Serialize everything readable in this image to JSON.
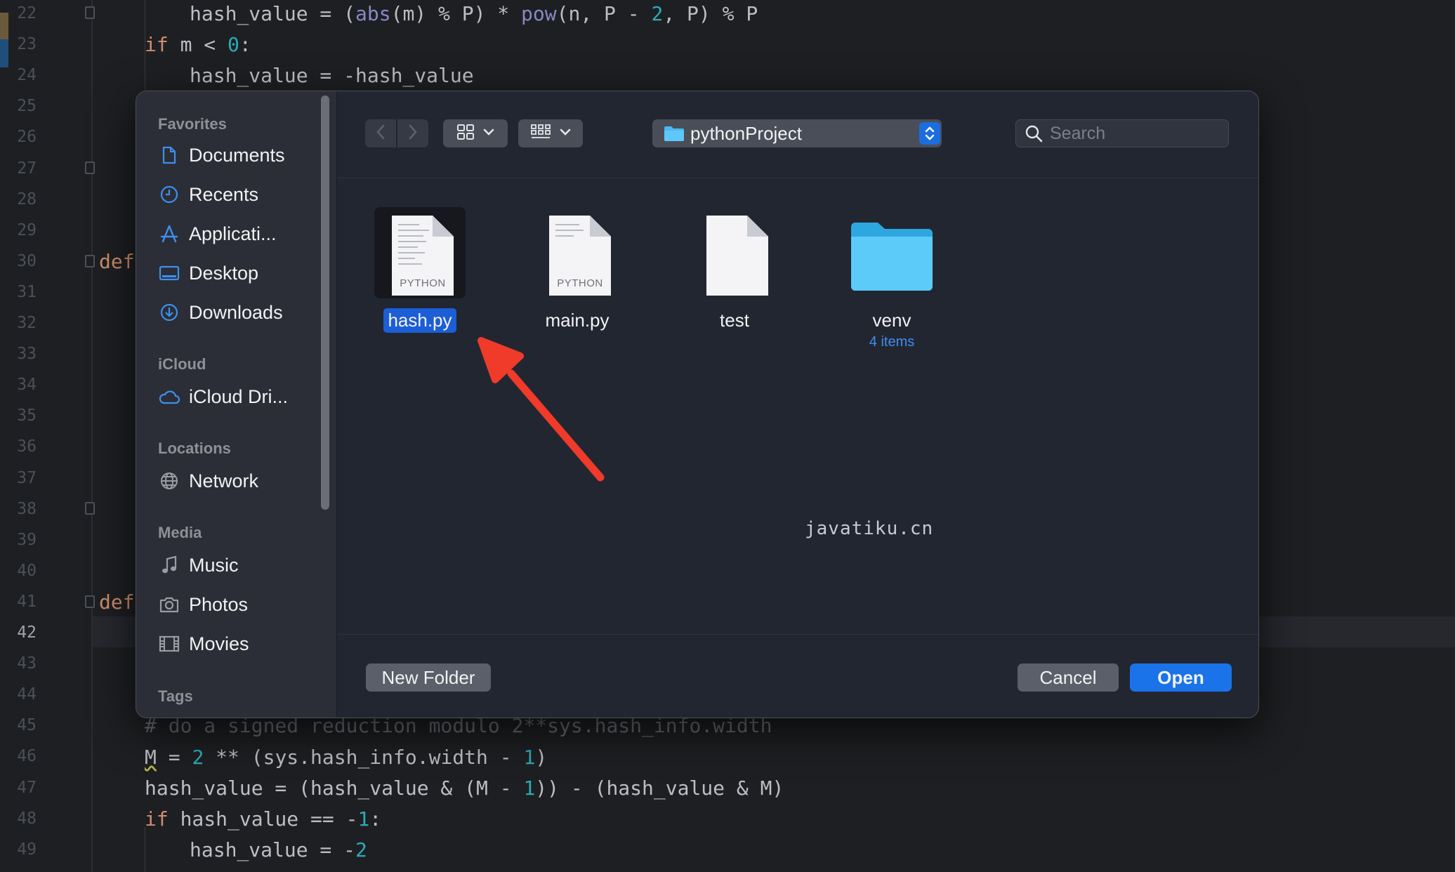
{
  "editor": {
    "line_numbers": [
      "22",
      "23",
      "24",
      "25",
      "26",
      "27",
      "28",
      "29",
      "30",
      "31",
      "32",
      "33",
      "34",
      "35",
      "36",
      "37",
      "38",
      "39",
      "40",
      "41",
      "42",
      "43",
      "44",
      "45",
      "46",
      "47",
      "48",
      "49"
    ],
    "current_line": "42",
    "lines_visible": {
      "l22": "hash_value = (abs(m) % P) * pow(n, P - 2, P) % P",
      "l23": "if m < 0:",
      "l24": "hash_value = -hash_value",
      "l30": "def",
      "l41": "def",
      "l45": "# do a signed reduction modulo 2**sys.hash_info.width",
      "l46": "M = 2 ** (sys.hash_info.width - 1)",
      "l47": "hash_value = (hash_value & (M - 1)) - (hash_value & M)",
      "l48": "if hash_value == -1:",
      "l49": "hash_value = -2"
    }
  },
  "dialog": {
    "sidebar": {
      "favorites_heading": "Favorites",
      "favorites": [
        {
          "label": "Documents",
          "icon": "document-icon"
        },
        {
          "label": "Recents",
          "icon": "clock-icon"
        },
        {
          "label": "Applicati...",
          "icon": "applications-icon"
        },
        {
          "label": "Desktop",
          "icon": "desktop-icon"
        },
        {
          "label": "Downloads",
          "icon": "download-icon"
        }
      ],
      "icloud_heading": "iCloud",
      "icloud": [
        {
          "label": "iCloud Dri...",
          "icon": "cloud-icon"
        }
      ],
      "locations_heading": "Locations",
      "locations": [
        {
          "label": "Network",
          "icon": "globe-icon"
        }
      ],
      "media_heading": "Media",
      "media": [
        {
          "label": "Music",
          "icon": "music-note-icon"
        },
        {
          "label": "Photos",
          "icon": "camera-icon"
        },
        {
          "label": "Movies",
          "icon": "film-icon"
        }
      ],
      "tags_heading": "Tags"
    },
    "toolbar": {
      "location": "pythonProject",
      "search_placeholder": "Search"
    },
    "files": [
      {
        "name": "hash.py",
        "kind": "PYTHON",
        "selected": true
      },
      {
        "name": "main.py",
        "kind": "PYTHON",
        "selected": false
      },
      {
        "name": "test",
        "kind": "",
        "selected": false
      },
      {
        "name": "venv",
        "subtitle": "4 items",
        "kind": "folder",
        "selected": false
      }
    ],
    "watermark": "javatiku.cn",
    "buttons": {
      "new_folder": "New Folder",
      "cancel": "Cancel",
      "open": "Open"
    }
  },
  "colors": {
    "accent": "#1a73e8",
    "selection": "#1b5ed6",
    "folder": "#4cc2f5",
    "annotation_arrow": "#f03a2a"
  }
}
